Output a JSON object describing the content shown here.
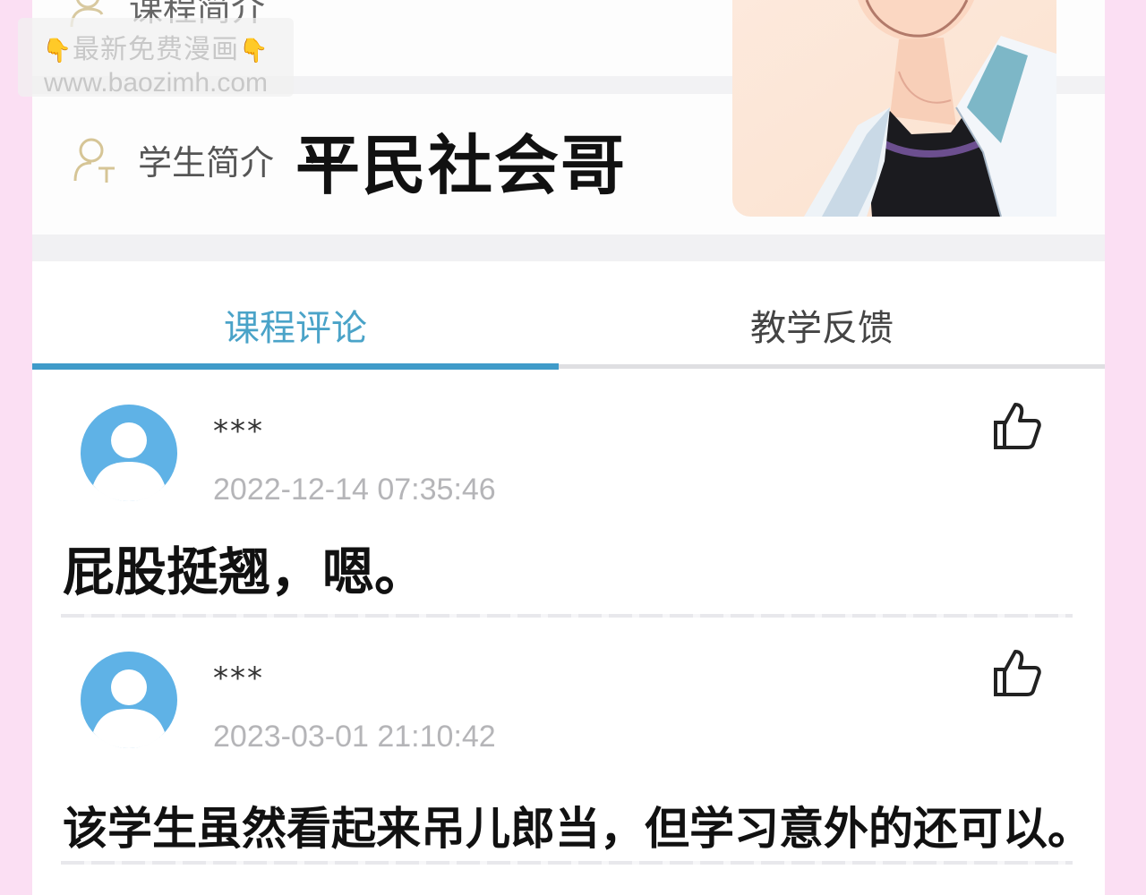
{
  "watermark": {
    "line1_prefix": "👇",
    "line1_text": "最新免费漫画",
    "line1_suffix": "👇",
    "line2": "www.baozimh.com"
  },
  "profile": {
    "course_intro_label": "课程简介",
    "student_intro_label": "学生简介",
    "student_nickname": "平民社会哥"
  },
  "tabs": [
    {
      "label": "课程评论",
      "active": true
    },
    {
      "label": "教学反馈",
      "active": false
    }
  ],
  "comments": [
    {
      "user": "***",
      "time": "2022-12-14 07:35:46",
      "text": "屁股挺翘，嗯。"
    },
    {
      "user": "***",
      "time": "2023-03-01 21:10:42",
      "text": "该学生虽然看起来吊儿郎当，但学习意外的还可以。"
    }
  ],
  "colors": {
    "accent": "#3f9bc9",
    "page_background": "#fbdff3",
    "avatar": "#5fb2e6"
  }
}
